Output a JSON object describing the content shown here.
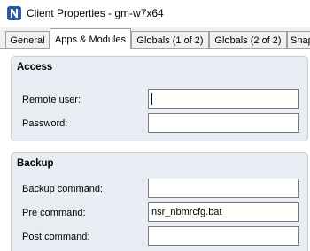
{
  "window": {
    "title": "Client Properties - gm-w7x64",
    "icon": "networker-n-icon"
  },
  "tabs": [
    {
      "label": "General",
      "active": false
    },
    {
      "label": "Apps & Modules",
      "active": true
    },
    {
      "label": "Globals (1 of 2)",
      "active": false
    },
    {
      "label": "Globals (2 of 2)",
      "active": false
    },
    {
      "label": "Snap",
      "active": false
    }
  ],
  "access": {
    "title": "Access",
    "remote_user": {
      "label": "Remote user:",
      "value": ""
    },
    "password": {
      "label": "Password:",
      "value": ""
    }
  },
  "backup": {
    "title": "Backup",
    "backup_command": {
      "label": "Backup command:",
      "value": ""
    },
    "pre_command": {
      "label": "Pre command:",
      "value": "nsr_nbmrcfg.bat"
    },
    "post_command": {
      "label": "Post command:",
      "value": ""
    }
  }
}
